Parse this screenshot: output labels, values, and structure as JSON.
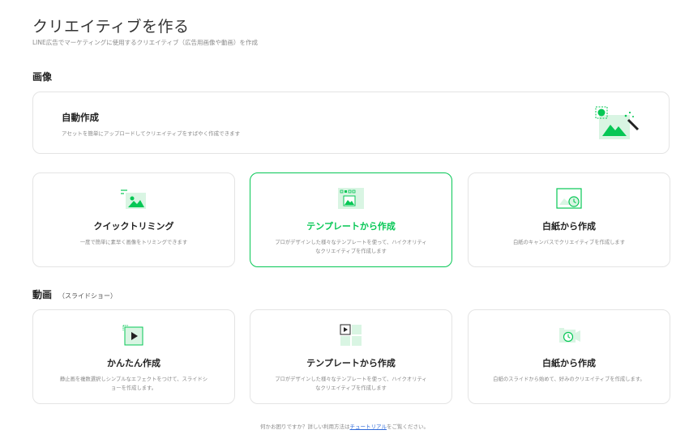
{
  "header": {
    "title": "クリエイティブを作る",
    "subtitle": "LINE広告でマーケティングに使用するクリエイティブ（広告用画像や動画）を作成"
  },
  "image_section": {
    "heading": "画像",
    "auto": {
      "title": "自動作成",
      "description": "アセットを簡単にアップロードしてクリエイティブをすばやく作成できます"
    },
    "cards": [
      {
        "title": "クイックトリミング",
        "description": "一度で簡単に素早く画像をトリミングできます"
      },
      {
        "title": "テンプレートから作成",
        "description": "プロがデザインした様々なテンプレートを使って、ハイクオリティなクリエイティブを作成します"
      },
      {
        "title": "白紙から作成",
        "description": "白紙のキャンバスでクリエイティブを作成します"
      }
    ]
  },
  "video_section": {
    "heading": "動画",
    "subheading": "（スライドショー）",
    "cards": [
      {
        "title": "かんたん作成",
        "description": "静止画を複数選択しシンプルなエフェクトをつけて、スライドショーを作成します。"
      },
      {
        "title": "テンプレートから作成",
        "description": "プロがデザインした様々なテンプレートを使って、ハイクオリティなクリエイティブを作成します"
      },
      {
        "title": "白紙から作成",
        "description": "白紙のスライドから始めて、好みのクリエイティブを作成します。"
      }
    ]
  },
  "footer": {
    "prefix": "何かお困りですか？詳しい利用方法は",
    "link": "チュートリアル",
    "suffix": "をご覧ください。"
  },
  "colors": {
    "accent": "#06c755",
    "accent_light": "#d9f5e3",
    "border": "#e4e4e4"
  }
}
